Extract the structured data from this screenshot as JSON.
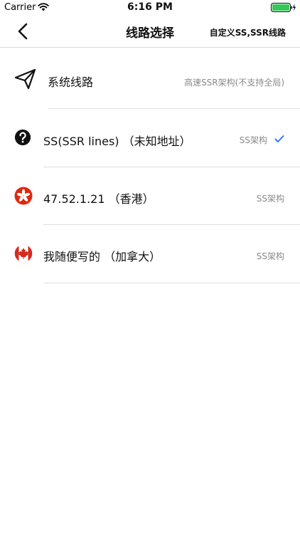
{
  "status_bar": {
    "carrier": "Carrier",
    "time": "6:16 PM",
    "battery_color": "#34c759"
  },
  "nav": {
    "title": "线路选择",
    "right_action": "自定义SS,SSR线路"
  },
  "rows": [
    {
      "icon": "paper-plane-icon",
      "label": "系统线路",
      "detail": "高速SSR架构(不支持全局)",
      "selected": false
    },
    {
      "icon": "question-circle-icon",
      "label": "SS(SSR lines) （未知地址）",
      "detail": "SS架构",
      "selected": true
    },
    {
      "icon": "hong-kong-flag-icon",
      "label": "47.52.1.21 （香港）",
      "detail": "SS架构",
      "selected": false
    },
    {
      "icon": "canada-flag-icon",
      "label": "我随便写的 （加拿大）",
      "detail": "SS架构",
      "selected": false
    }
  ],
  "colors": {
    "check": "#2f7cf6",
    "detail_text": "#8a8a8a",
    "divider": "#dedede"
  }
}
